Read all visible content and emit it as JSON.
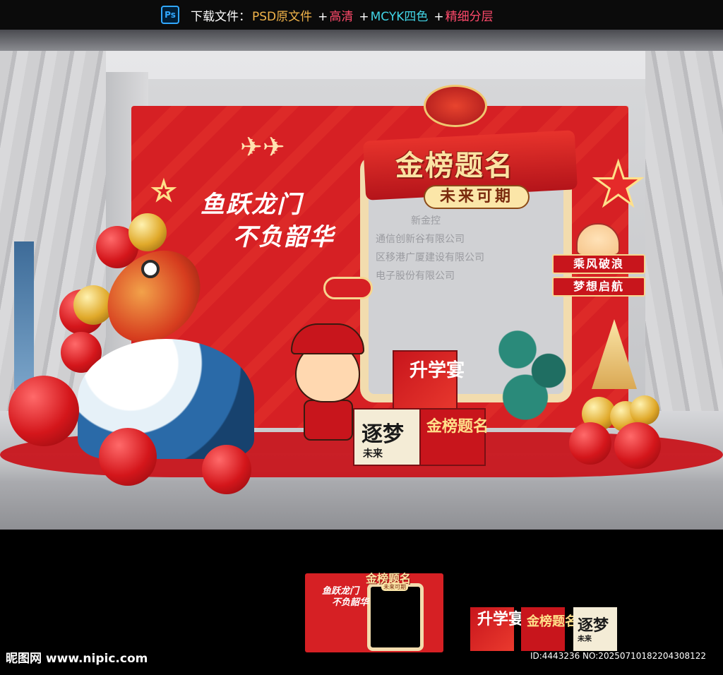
{
  "topbar": {
    "logo": "Ps",
    "label": "下载文件：",
    "psd": "PSD原文件",
    "hd": "高清",
    "mcyk": "MCYK四色",
    "layers": "精细分层",
    "plus": "+"
  },
  "board": {
    "slogan_line1": "鱼跃龙门",
    "slogan_line2": "不负韶华",
    "title": "金榜题名",
    "subtitle": "未来可期",
    "tag1": "乘风破浪",
    "tag2": "梦想启航"
  },
  "boxes": {
    "top": "升学宴",
    "left_main": "逐梦",
    "left_sub": "未来",
    "right": "金榜题名"
  },
  "background_text": {
    "line1": "新金控",
    "line2": "通信创新谷有限公司",
    "line3": "区移港广厦建设有限公司",
    "line4": "电子股份有限公司"
  },
  "preview": {
    "title": "金榜题名",
    "subtitle": "未来可期",
    "slogan_line1": "鱼跃龙门",
    "slogan_line2": "不负韶华",
    "tile1": "升学宴",
    "tile2": "金榜题名",
    "tile3_main": "逐梦",
    "tile3_sub": "未来"
  },
  "footer": {
    "watermark": "昵图网 www.nipic.com",
    "id_line": "ID:4443236 NO:20250710182204308122"
  },
  "colors": {
    "board_red": "#d62024",
    "gold": "#fbe3a3",
    "ps_blue": "#31a8ff"
  }
}
